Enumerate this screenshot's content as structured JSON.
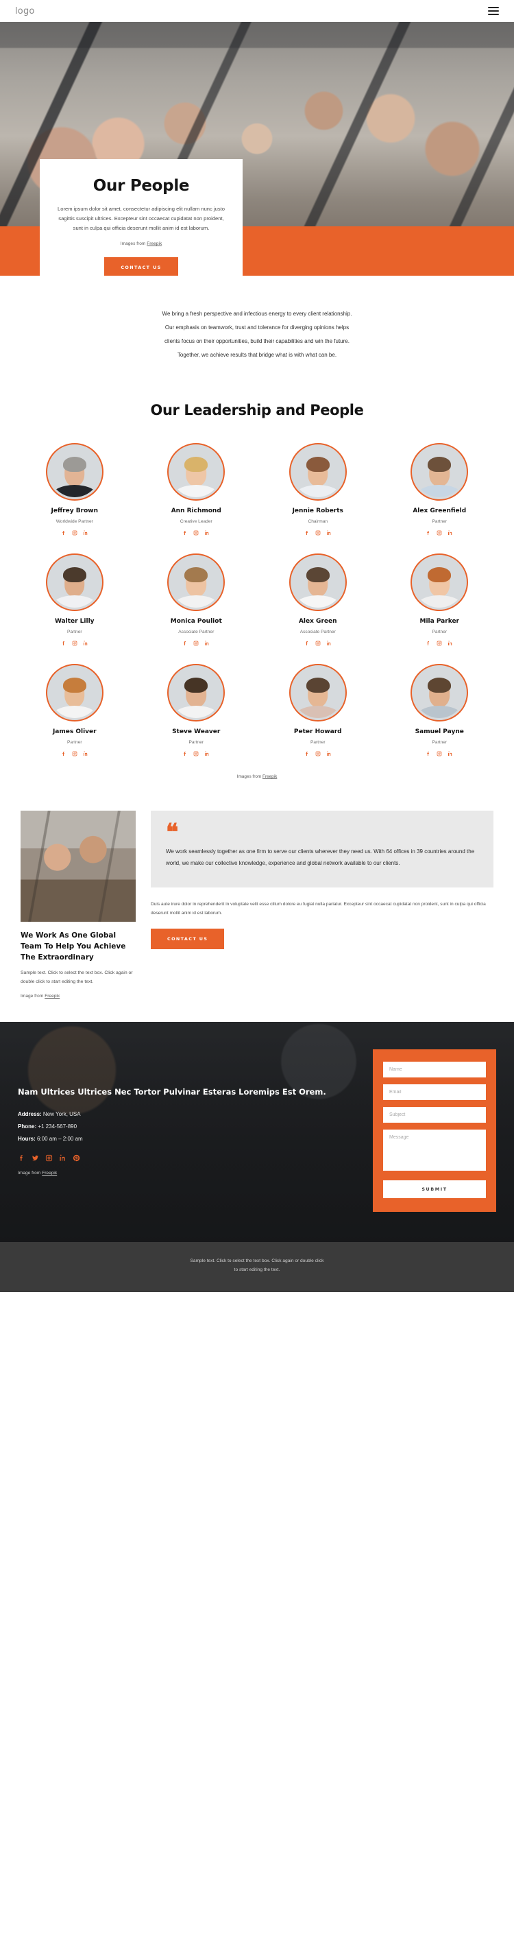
{
  "header": {
    "logo": "logo",
    "menu_icon": "hamburger-menu-icon"
  },
  "hero": {
    "title": "Our People",
    "paragraph": "Lorem ipsum dolor sit amet, consectetur adipiscing elit nullam nunc justo sagittis suscipit ultrices. Excepteur sint occaecat cupidatat non proident, sunt in culpa qui officia deserunt mollit anim id est laborum.",
    "credit_prefix": "Images from ",
    "credit_link": "Freepik",
    "cta": "CONTACT US"
  },
  "intro": {
    "line1": "We bring a fresh perspective and infectious energy to every client relationship.",
    "line2": "Our emphasis on teamwork, trust and tolerance for diverging opinions helps",
    "line3": "clients focus on their opportunities, build their capabilities and win the future.",
    "line4": "Together, we achieve results that bridge what is with what can be."
  },
  "team": {
    "heading": "Our Leadership and People",
    "credit_prefix": "Images from ",
    "credit_link": "Freepik",
    "social_icons": [
      "facebook-icon",
      "instagram-icon",
      "linkedin-icon"
    ],
    "members": [
      {
        "name": "Jeffrey Brown",
        "role": "Worldwide Partner",
        "skin": "#e2b495",
        "hair": "#9c9a96",
        "shirt": "#23262b"
      },
      {
        "name": "Ann Richmond",
        "role": "Creative Leader",
        "skin": "#eec6a6",
        "hair": "#d9b36a",
        "shirt": "#f4f5f6"
      },
      {
        "name": "Jennie Roberts",
        "role": "Chairman",
        "skin": "#e8bb99",
        "hair": "#8a5a3c",
        "shirt": "#eceff3"
      },
      {
        "name": "Alex Greenfield",
        "role": "Partner",
        "skin": "#e3b694",
        "hair": "#6d513b",
        "shirt": "#c7d6e4"
      },
      {
        "name": "Walter Lilly",
        "role": "Partner",
        "skin": "#dfae8b",
        "hair": "#4b3a2c",
        "shirt": "#f0f1f3"
      },
      {
        "name": "Monica Pouliot",
        "role": "Associate Partner",
        "skin": "#edc3a2",
        "hair": "#a37a4e",
        "shirt": "#f2f2f2"
      },
      {
        "name": "Alex Green",
        "role": "Associate Partner",
        "skin": "#e5b694",
        "hair": "#5b4635",
        "shirt": "#f6f6f6"
      },
      {
        "name": "Mila Parker",
        "role": "Partner",
        "skin": "#f0c6a5",
        "hair": "#c06a32",
        "shirt": "#efefef"
      },
      {
        "name": "James Oliver",
        "role": "Partner",
        "skin": "#e8bd99",
        "hair": "#c67d3c",
        "shirt": "#f4f4f4"
      },
      {
        "name": "Steve Weaver",
        "role": "Partner",
        "skin": "#e2b392",
        "hair": "#463425",
        "shirt": "#f3f3f3"
      },
      {
        "name": "Peter Howard",
        "role": "Partner",
        "skin": "#e5b794",
        "hair": "#5a4433",
        "shirt": "#d9c0b4"
      },
      {
        "name": "Samuel Payne",
        "role": "Partner",
        "skin": "#e0b08d",
        "hair": "#5e4632",
        "shirt": "#b9c4cd"
      }
    ]
  },
  "global": {
    "quote_mark": "“",
    "quote": "We work seamlessly together as one firm to serve our clients wherever they need us. With 64 offices in 39 countries around the world, we make our collective knowledge, experience and global network available to our clients.",
    "right_text": "Duis aute irure dolor in reprehenderit in voluptate velit esse cillum dolore eu fugiat nulla pariatur. Excepteur sint occaecat cupidatat non proident, sunt in culpa qui officia deserunt mollit anim id est laborum.",
    "cta": "CONTACT US",
    "title": "We Work As One Global Team To Help You Achieve The Extraordinary",
    "sample": "Sample text. Click to select the text box. Click again or double click to start editing the text.",
    "credit_prefix": "Image from ",
    "credit_link": "Freepik"
  },
  "contact": {
    "title": "Nam Ultrices Ultrices Nec Tortor Pulvinar Esteras Loremips Est Orem.",
    "address_label": "Address:",
    "address_value": " New York, USA",
    "phone_label": "Phone:",
    "phone_value": " +1 234-567-890",
    "hours_label": "Hours:",
    "hours_value": " 6:00 am – 2:00 am",
    "social_icons": [
      "facebook-icon",
      "twitter-icon",
      "instagram-icon",
      "linkedin-icon",
      "pinterest-icon"
    ],
    "credit_prefix": "Image from ",
    "credit_link": "Freepik",
    "form": {
      "name_placeholder": "Name",
      "email_placeholder": "Email",
      "subject_placeholder": "Subject",
      "message_placeholder": "Message",
      "submit_label": "SUBMIT"
    }
  },
  "footer": {
    "line1": "Sample text. Click to select the text box. Click again or double click",
    "line2": "to start editing the text."
  },
  "colors": {
    "accent": "#e8622a",
    "dark": "#3b3b3b",
    "quote_bg": "#e9e9e9"
  }
}
